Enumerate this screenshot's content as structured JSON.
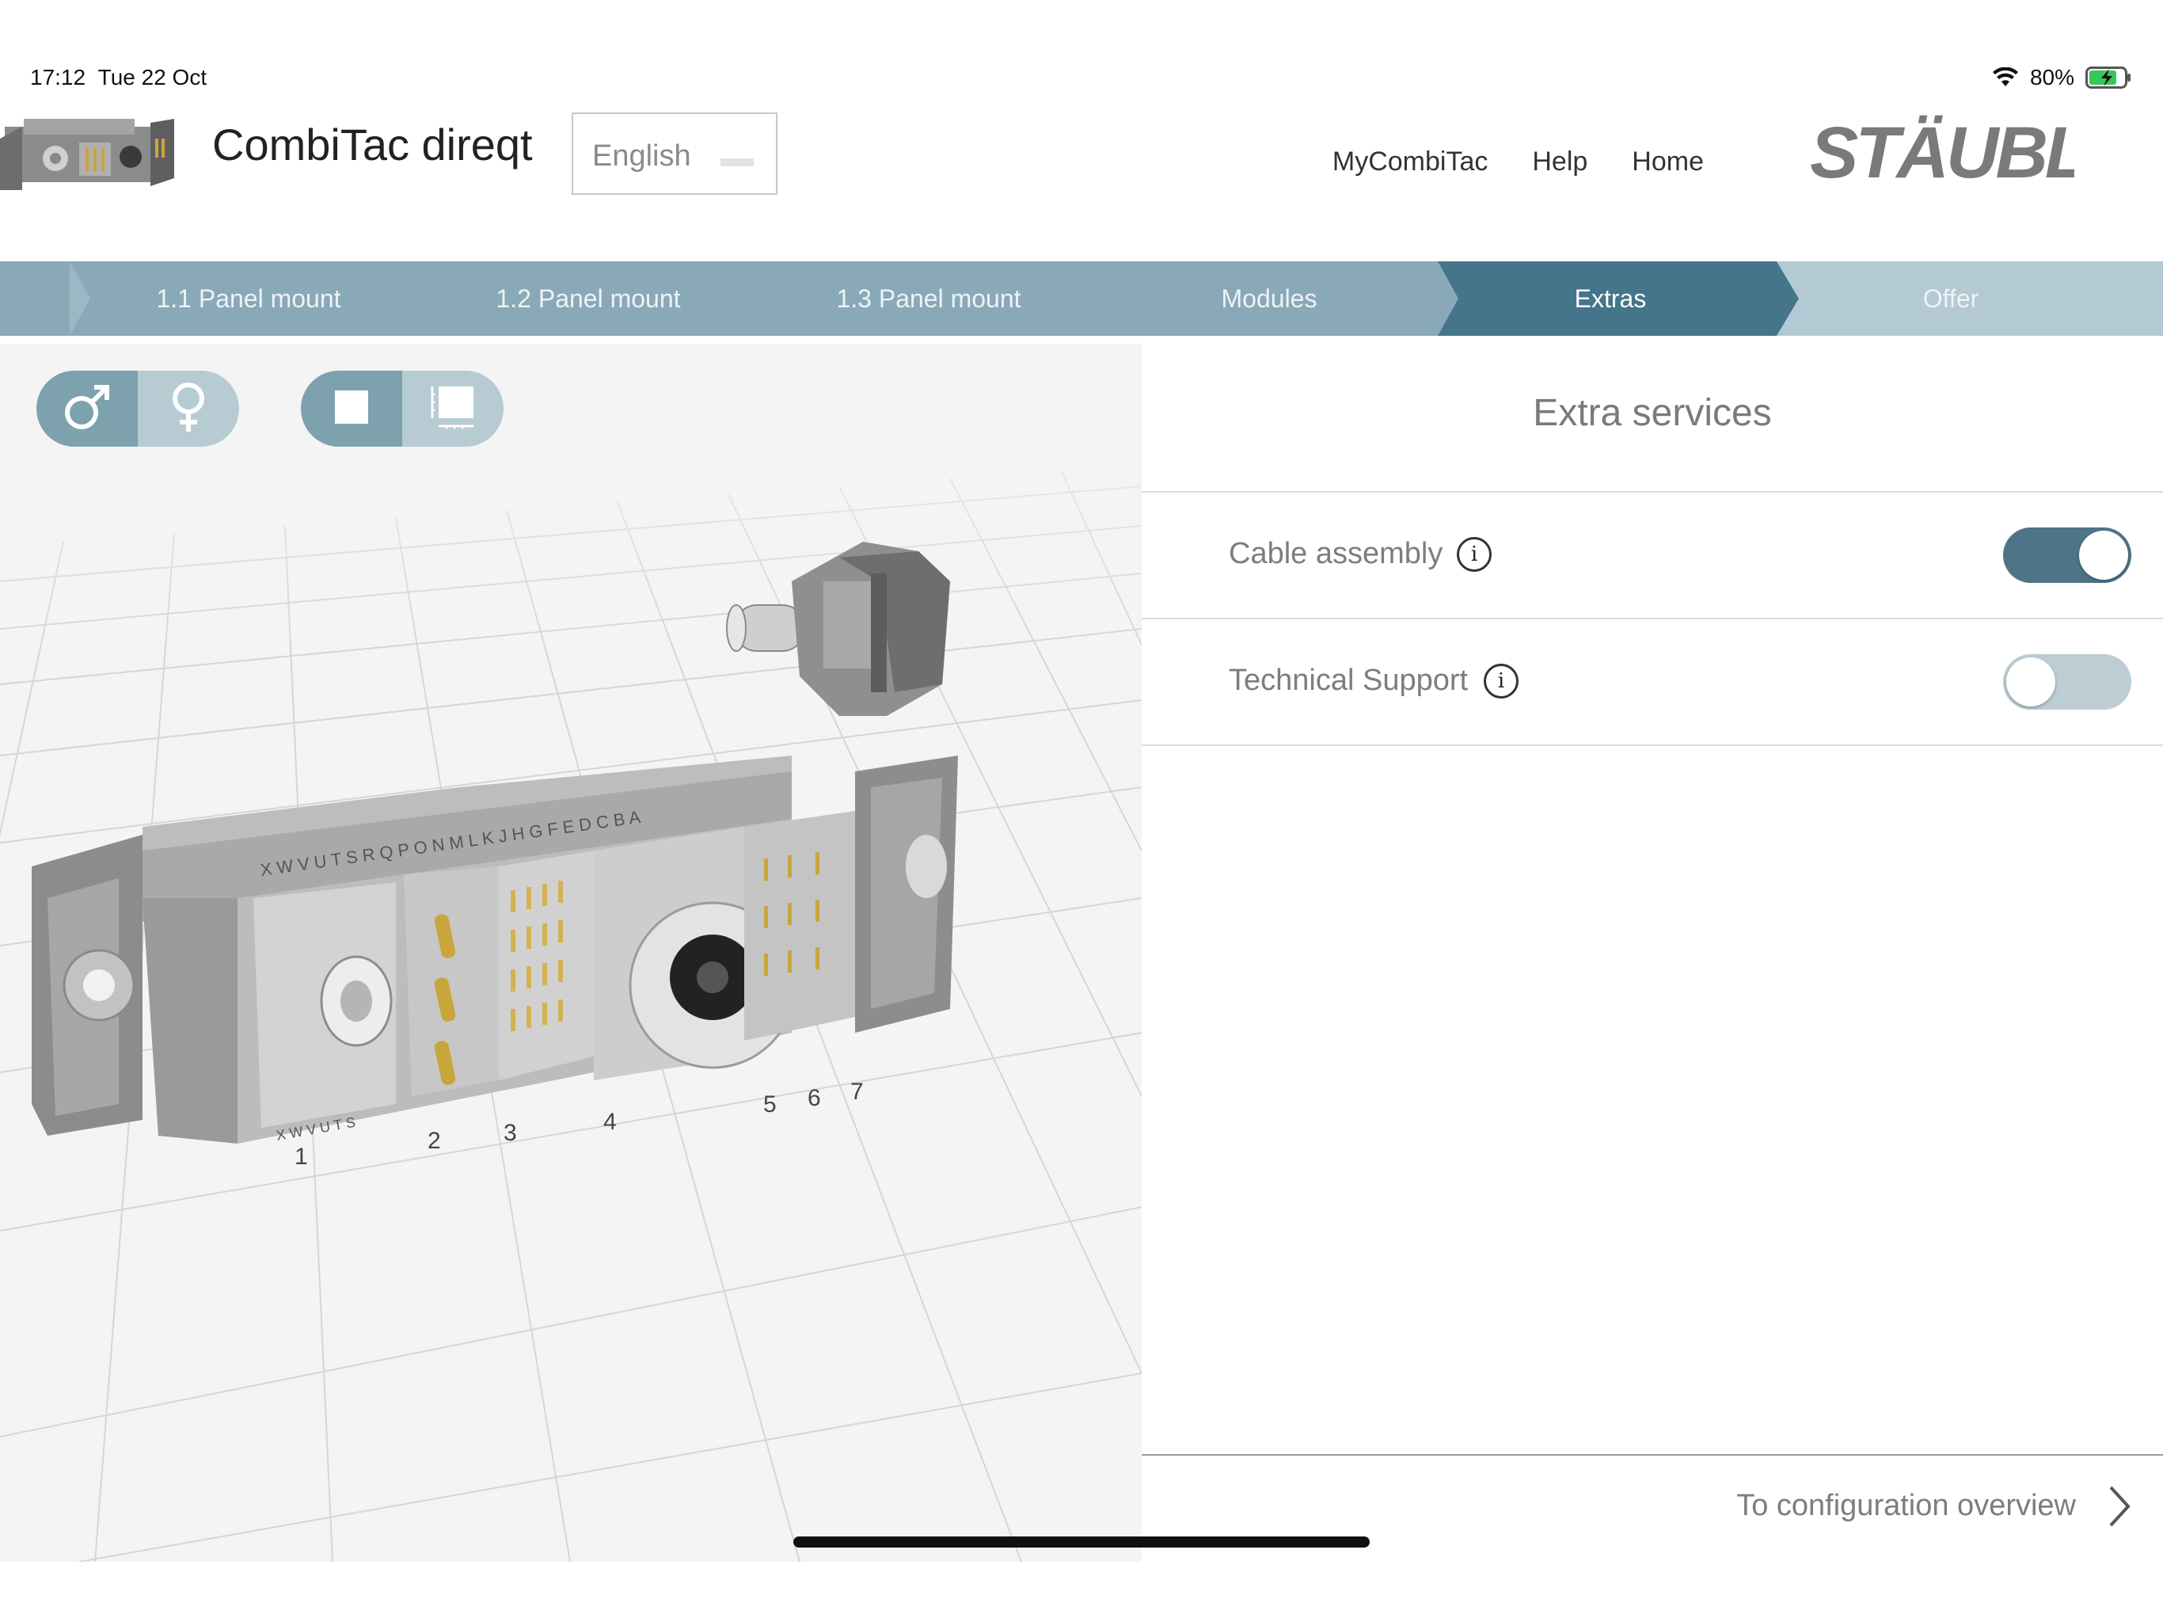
{
  "status": {
    "time": "17:12",
    "date": "Tue 22 Oct",
    "battery": "80%"
  },
  "header": {
    "title": "CombiTac direqt",
    "language": "English",
    "nav": [
      "MyCombiTac",
      "Help",
      "Home"
    ],
    "brand": "STÄUBLI"
  },
  "steps": [
    {
      "label": "1.1 Panel mount",
      "state": "done"
    },
    {
      "label": "1.2 Panel mount",
      "state": "done"
    },
    {
      "label": "1.3 Panel mount",
      "state": "done"
    },
    {
      "label": "Modules",
      "state": "done"
    },
    {
      "label": "Extras",
      "state": "active"
    },
    {
      "label": "Offer",
      "state": "upcoming"
    }
  ],
  "viewer": {
    "gender_toggle": {
      "selected": "male"
    },
    "view_toggle": {
      "selected": "solid"
    },
    "module_numbers": [
      "1",
      "2",
      "3",
      "4",
      "5",
      "6",
      "7"
    ],
    "pin_letters_top": "X W V U T S R Q P O N M L K J H G F E D C B A",
    "pin_letters_bottom": "X W V U T S"
  },
  "panel": {
    "title": "Extra services",
    "options": [
      {
        "label": "Cable assembly",
        "enabled": true
      },
      {
        "label": "Technical Support",
        "enabled": false
      }
    ],
    "footer_link": "To configuration overview"
  },
  "colors": {
    "step_bar": "#8aa9b8",
    "step_active": "#44758a",
    "step_upcoming": "#b3c9d3",
    "switch_on": "#4f7487",
    "switch_off": "#bccdd4"
  }
}
